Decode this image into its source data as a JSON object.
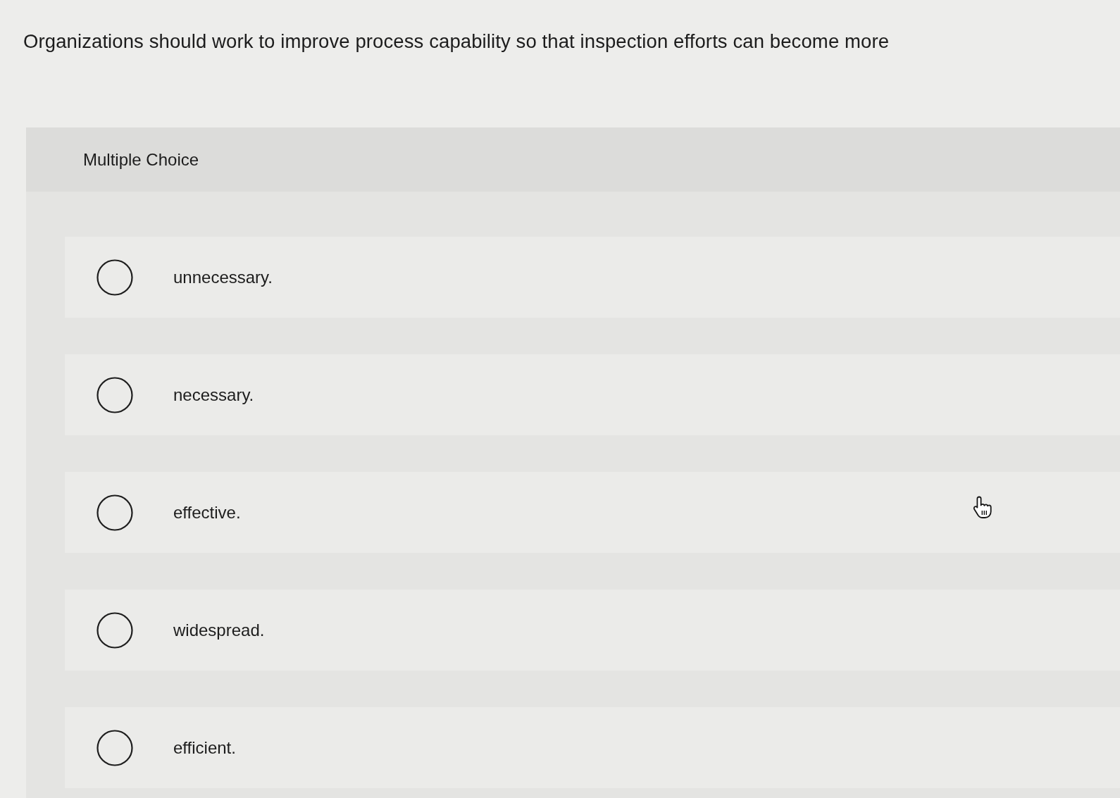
{
  "question": "Organizations should work to improve process capability so that inspection efforts can become more",
  "section": {
    "title": "Multiple Choice"
  },
  "options": [
    {
      "label": "unnecessary.",
      "selected": false
    },
    {
      "label": "necessary.",
      "selected": false
    },
    {
      "label": "effective.",
      "selected": false
    },
    {
      "label": "widespread.",
      "selected": false
    },
    {
      "label": "efficient.",
      "selected": false
    }
  ]
}
